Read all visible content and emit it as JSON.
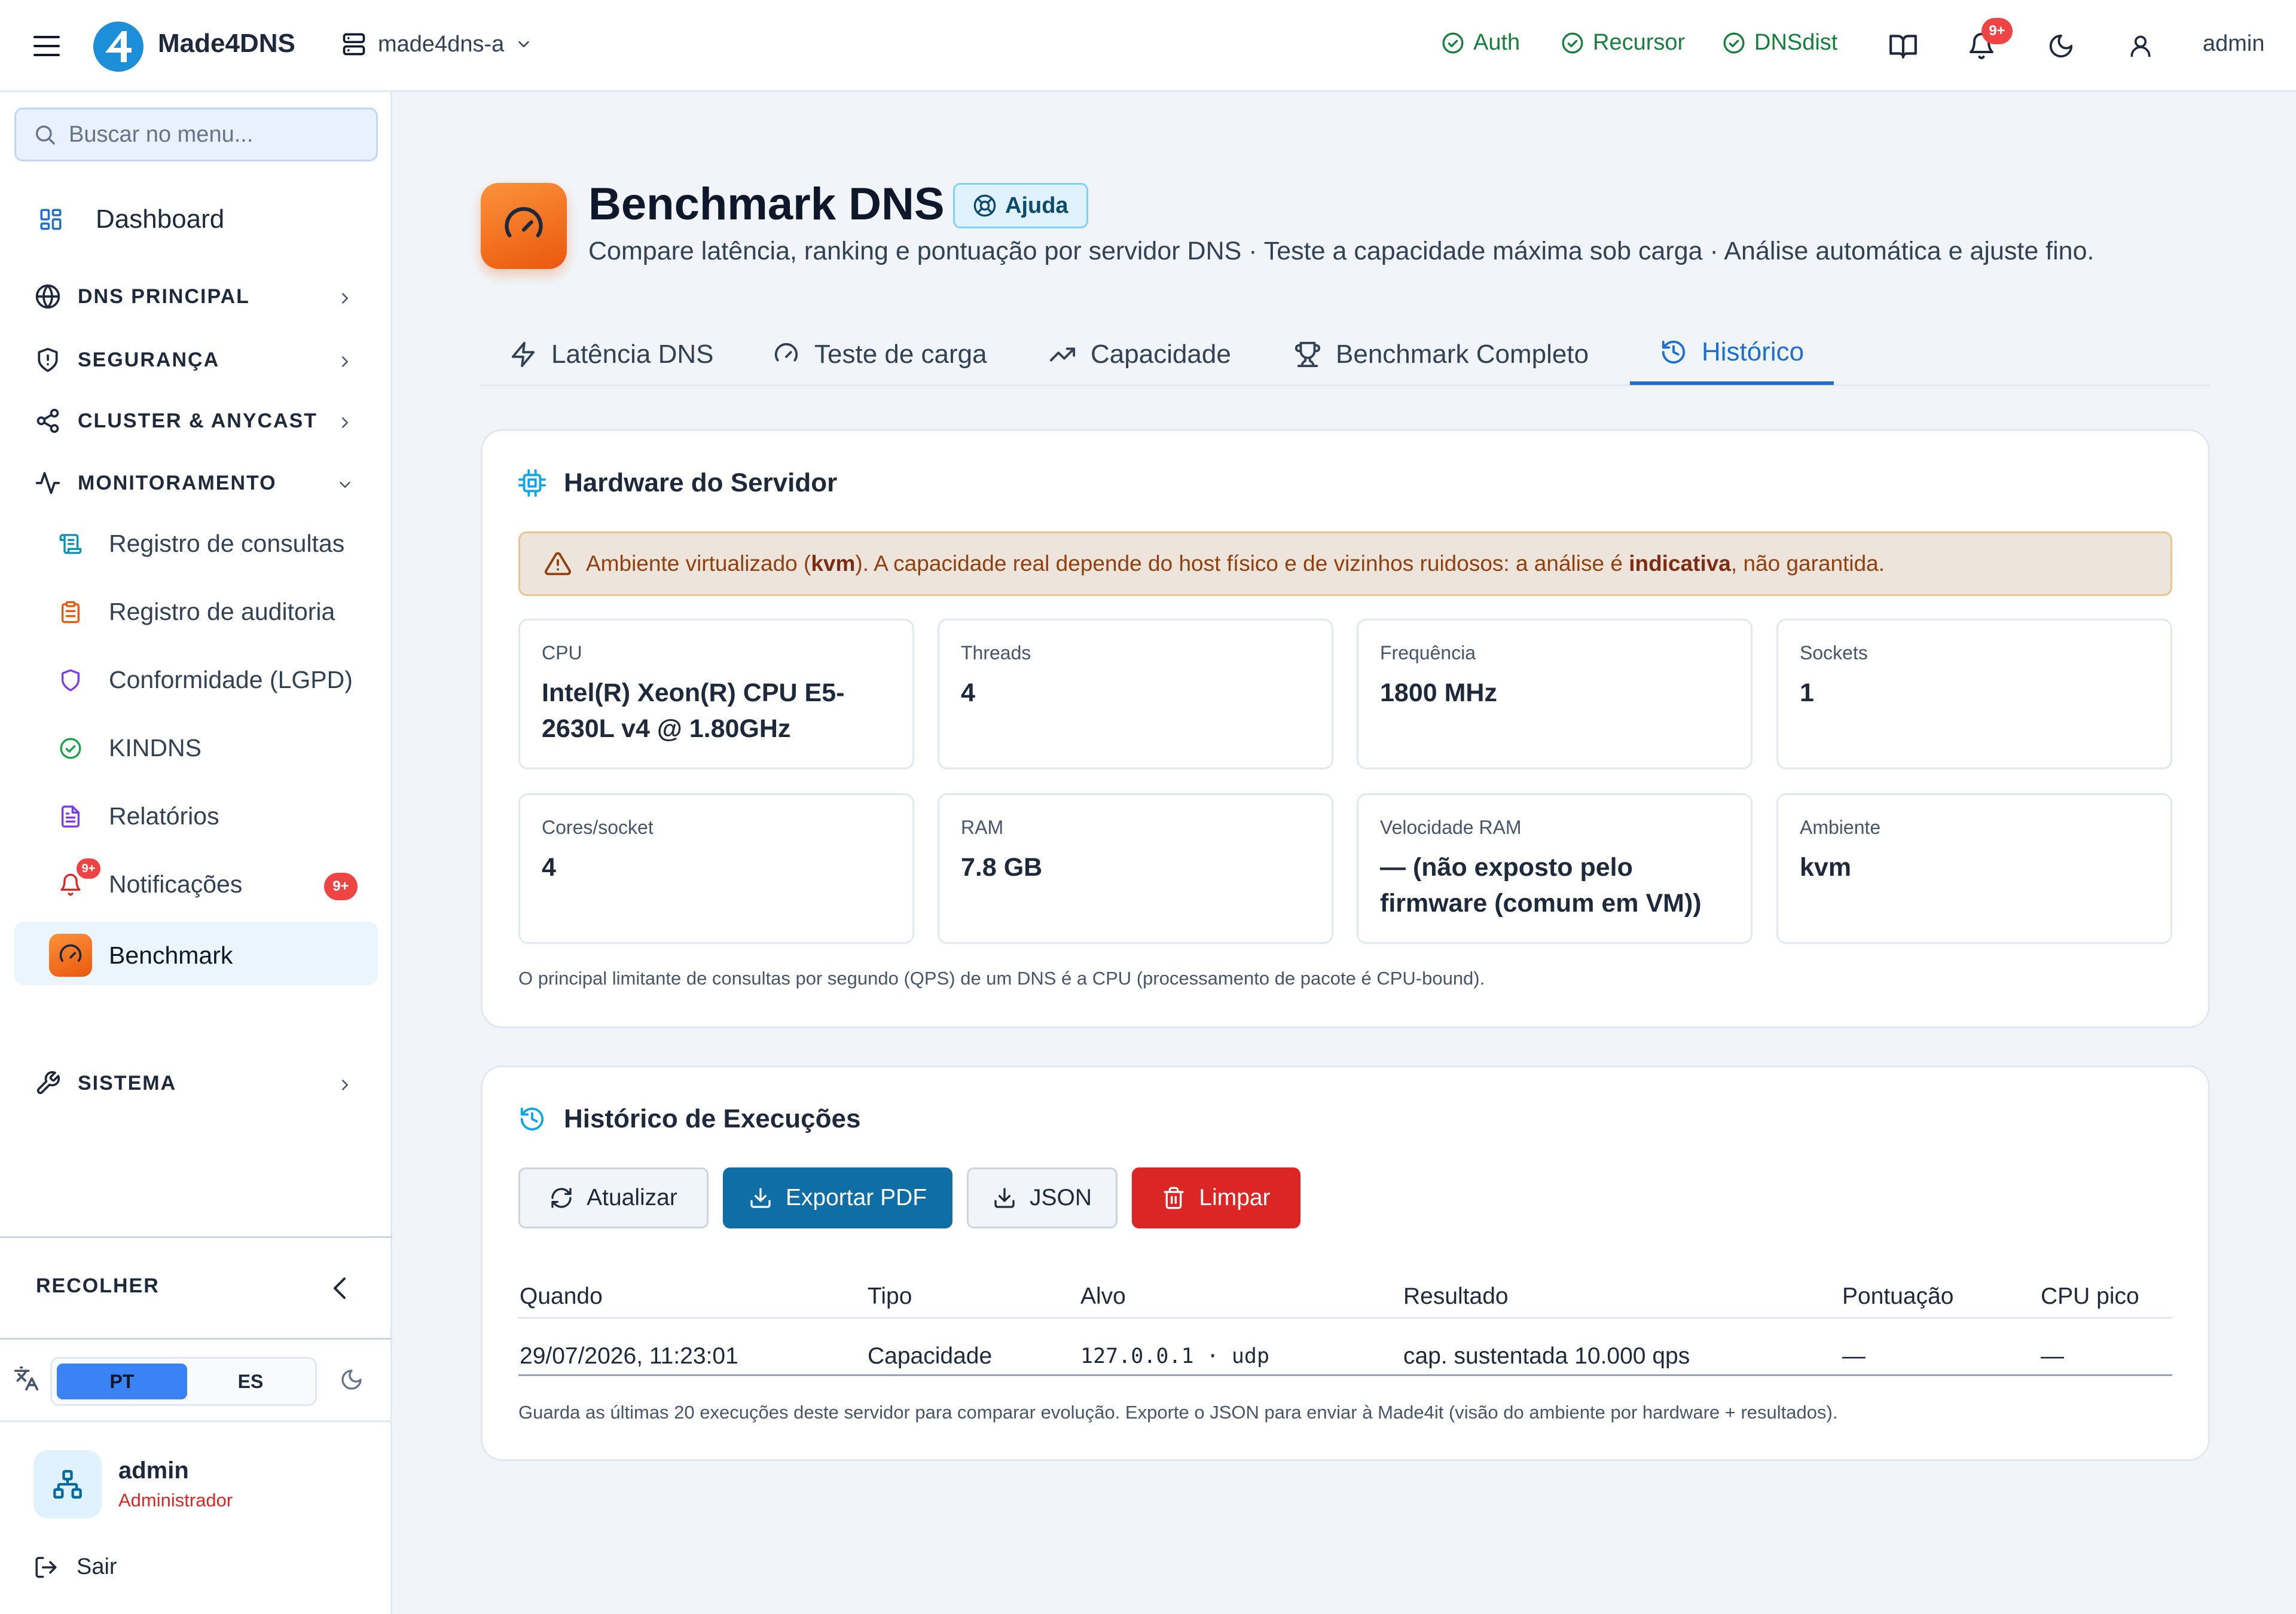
{
  "header": {
    "brand": "Made4DNS",
    "server": "made4dns-a",
    "services": [
      {
        "label": "Auth",
        "status_color": "#15803d"
      },
      {
        "label": "Recursor",
        "status_color": "#15803d"
      },
      {
        "label": "DNSdist",
        "status_color": "#15803d"
      }
    ],
    "notif_count": "9+",
    "user": "admin"
  },
  "sidebar": {
    "search_placeholder": "Buscar no menu...",
    "dashboard": "Dashboard",
    "sections": {
      "dns": "DNS PRINCIPAL",
      "security": "SEGURANÇA",
      "cluster": "CLUSTER & ANYCAST",
      "monitoring": "MONITORAMENTO",
      "system": "SISTEMA"
    },
    "monitoring_items": [
      {
        "label": "Registro de consultas",
        "icon": "scroll-icon"
      },
      {
        "label": "Registro de auditoria",
        "icon": "clipboard-icon"
      },
      {
        "label": "Conformidade (LGPD)",
        "icon": "shield-icon"
      },
      {
        "label": "KINDNS",
        "icon": "check-circle-icon"
      },
      {
        "label": "Relatórios",
        "icon": "file-text-icon"
      },
      {
        "label": "Notificações",
        "icon": "bell-icon",
        "badge": "9+"
      },
      {
        "label": "Benchmark",
        "icon": "gauge-icon",
        "active": true
      }
    ],
    "collapse_label": "RECOLHER",
    "languages": [
      "PT",
      "ES"
    ],
    "selected_language": "PT",
    "user": {
      "name": "admin",
      "role": "Administrador"
    },
    "logout": "Sair"
  },
  "page": {
    "title": "Benchmark DNS",
    "help": "Ajuda",
    "subtitle": "Compare latência, ranking e pontuação por servidor DNS · Teste a capacidade máxima sob carga · Análise automática e ajuste fino.",
    "tabs": [
      {
        "label": "Latência DNS",
        "icon": "zap-icon"
      },
      {
        "label": "Teste de carga",
        "icon": "gauge-icon"
      },
      {
        "label": "Capacidade",
        "icon": "trending-up-icon"
      },
      {
        "label": "Benchmark Completo",
        "icon": "trophy-icon"
      },
      {
        "label": "Histórico",
        "icon": "history-icon",
        "active": true
      }
    ]
  },
  "hardware": {
    "title": "Hardware do Servidor",
    "warning": {
      "before": "Ambiente virtualizado (",
      "env": "kvm",
      "middle": "). A capacidade real depende do host físico e de vizinhos ruidosos: a análise é ",
      "strong": "indicativa",
      "after": ", não garantida."
    },
    "cards": [
      {
        "label": "CPU",
        "value": "Intel(R) Xeon(R) CPU E5-2630L v4 @ 1.80GHz"
      },
      {
        "label": "Threads",
        "value": "4"
      },
      {
        "label": "Frequência",
        "value": "1800 MHz"
      },
      {
        "label": "Sockets",
        "value": "1"
      },
      {
        "label": "Cores/socket",
        "value": "4"
      },
      {
        "label": "RAM",
        "value": "7.8 GB"
      },
      {
        "label": "Velocidade RAM",
        "value": "— (não exposto pelo firmware (comum em VM))"
      },
      {
        "label": "Ambiente",
        "value": "kvm"
      }
    ],
    "note": "O principal limitante de consultas por segundo (QPS) de um DNS é a CPU (processamento de pacote é CPU-bound)."
  },
  "history": {
    "title": "Histórico de Execuções",
    "buttons": {
      "refresh": "Atualizar",
      "pdf": "Exportar PDF",
      "json": "JSON",
      "clear": "Limpar"
    },
    "columns": [
      "Quando",
      "Tipo",
      "Alvo",
      "Resultado",
      "Pontuação",
      "CPU pico"
    ],
    "rows": [
      {
        "when": "29/07/2026, 11:23:01",
        "type": "Capacidade",
        "target": "127.0.0.1 · udp",
        "result": "cap. sustentada 10.000 qps",
        "score": "—",
        "cpu": "—"
      }
    ],
    "note": "Guarda as últimas 20 execuções deste servidor para comparar evolução. Exporte o JSON para enviar à Made4it (visão do ambiente por hardware + resultados)."
  }
}
